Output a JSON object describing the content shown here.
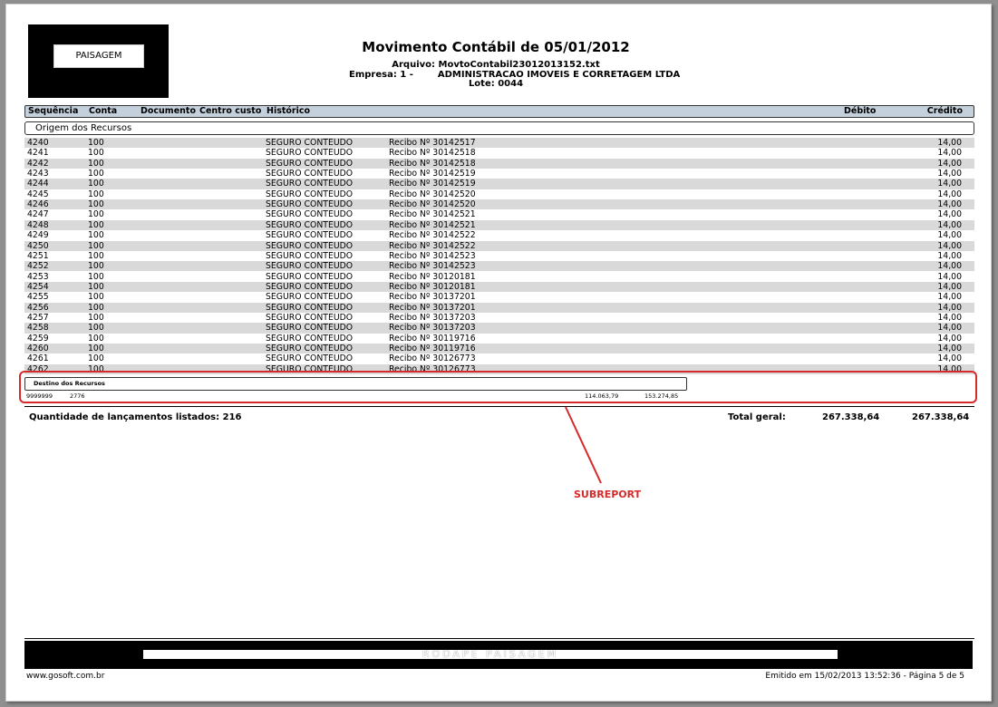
{
  "report": {
    "logo_text": "PAISAGEM",
    "title": "Movimento Contábil de 05/01/2012",
    "arquivo": "Arquivo: MovtoContabil23012013152.txt",
    "empresa_label": "Empresa: 1 -",
    "empresa_name": "ADMINISTRACAO IMOVEIS E CORRETAGEM LTDA",
    "lote": "Lote: 0044"
  },
  "columns": {
    "sequencia": "Sequência",
    "conta": "Conta",
    "documento": "Documento",
    "centro_custo": "Centro custo",
    "historico": "Histórico",
    "debito": "Débito",
    "credito": "Crédito"
  },
  "group_title": "Origem dos Recursos",
  "rows": [
    {
      "seq": "4240",
      "conta": "100",
      "hist": "SEGURO CONTEUDO",
      "comp": "Recibo Nº 30142517",
      "credito": "14,00"
    },
    {
      "seq": "4241",
      "conta": "100",
      "hist": "SEGURO CONTEUDO",
      "comp": "Recibo Nº 30142518",
      "credito": "14,00"
    },
    {
      "seq": "4242",
      "conta": "100",
      "hist": "SEGURO CONTEUDO",
      "comp": "Recibo Nº 30142518",
      "credito": "14,00"
    },
    {
      "seq": "4243",
      "conta": "100",
      "hist": "SEGURO CONTEUDO",
      "comp": "Recibo Nº 30142519",
      "credito": "14,00"
    },
    {
      "seq": "4244",
      "conta": "100",
      "hist": "SEGURO CONTEUDO",
      "comp": "Recibo Nº 30142519",
      "credito": "14,00"
    },
    {
      "seq": "4245",
      "conta": "100",
      "hist": "SEGURO CONTEUDO",
      "comp": "Recibo Nº 30142520",
      "credito": "14,00"
    },
    {
      "seq": "4246",
      "conta": "100",
      "hist": "SEGURO CONTEUDO",
      "comp": "Recibo Nº 30142520",
      "credito": "14,00"
    },
    {
      "seq": "4247",
      "conta": "100",
      "hist": "SEGURO CONTEUDO",
      "comp": "Recibo Nº 30142521",
      "credito": "14,00"
    },
    {
      "seq": "4248",
      "conta": "100",
      "hist": "SEGURO CONTEUDO",
      "comp": "Recibo Nº 30142521",
      "credito": "14,00"
    },
    {
      "seq": "4249",
      "conta": "100",
      "hist": "SEGURO CONTEUDO",
      "comp": "Recibo Nº 30142522",
      "credito": "14,00"
    },
    {
      "seq": "4250",
      "conta": "100",
      "hist": "SEGURO CONTEUDO",
      "comp": "Recibo Nº 30142522",
      "credito": "14,00"
    },
    {
      "seq": "4251",
      "conta": "100",
      "hist": "SEGURO CONTEUDO",
      "comp": "Recibo Nº 30142523",
      "credito": "14,00"
    },
    {
      "seq": "4252",
      "conta": "100",
      "hist": "SEGURO CONTEUDO",
      "comp": "Recibo Nº 30142523",
      "credito": "14,00"
    },
    {
      "seq": "4253",
      "conta": "100",
      "hist": "SEGURO CONTEUDO",
      "comp": "Recibo Nº 30120181",
      "credito": "14,00"
    },
    {
      "seq": "4254",
      "conta": "100",
      "hist": "SEGURO CONTEUDO",
      "comp": "Recibo Nº 30120181",
      "credito": "14,00"
    },
    {
      "seq": "4255",
      "conta": "100",
      "hist": "SEGURO CONTEUDO",
      "comp": "Recibo Nº 30137201",
      "credito": "14,00"
    },
    {
      "seq": "4256",
      "conta": "100",
      "hist": "SEGURO CONTEUDO",
      "comp": "Recibo Nº 30137201",
      "credito": "14,00"
    },
    {
      "seq": "4257",
      "conta": "100",
      "hist": "SEGURO CONTEUDO",
      "comp": "Recibo Nº 30137203",
      "credito": "14,00"
    },
    {
      "seq": "4258",
      "conta": "100",
      "hist": "SEGURO CONTEUDO",
      "comp": "Recibo Nº 30137203",
      "credito": "14,00"
    },
    {
      "seq": "4259",
      "conta": "100",
      "hist": "SEGURO CONTEUDO",
      "comp": "Recibo Nº 30119716",
      "credito": "14,00"
    },
    {
      "seq": "4260",
      "conta": "100",
      "hist": "SEGURO CONTEUDO",
      "comp": "Recibo Nº 30119716",
      "credito": "14,00"
    },
    {
      "seq": "4261",
      "conta": "100",
      "hist": "SEGURO CONTEUDO",
      "comp": "Recibo Nº 30126773",
      "credito": "14,00"
    },
    {
      "seq": "4262",
      "conta": "100",
      "hist": "SEGURO CONTEUDO",
      "comp": "Recibo Nº 30126773",
      "credito": "14,00"
    }
  ],
  "subreport": {
    "title": "Destino dos Recursos",
    "seq": "9999999",
    "conta": "2776",
    "debito": "114.063,79",
    "credito": "153.274,85"
  },
  "summary": {
    "quantidade": "Quantidade de lançamentos listados: 216",
    "total_label": "Total geral:",
    "total_debito": "267.338,64",
    "total_credito": "267.338,64"
  },
  "annotation": {
    "label": "SUBREPORT",
    "color": "#d62a2a"
  },
  "footer": {
    "rodape": "RODAPÉ PAISAGEM",
    "site": "www.gosoft.com.br",
    "emitido": "Emitido em 15/02/2013 13:52:36 - Página 5 de 5"
  }
}
